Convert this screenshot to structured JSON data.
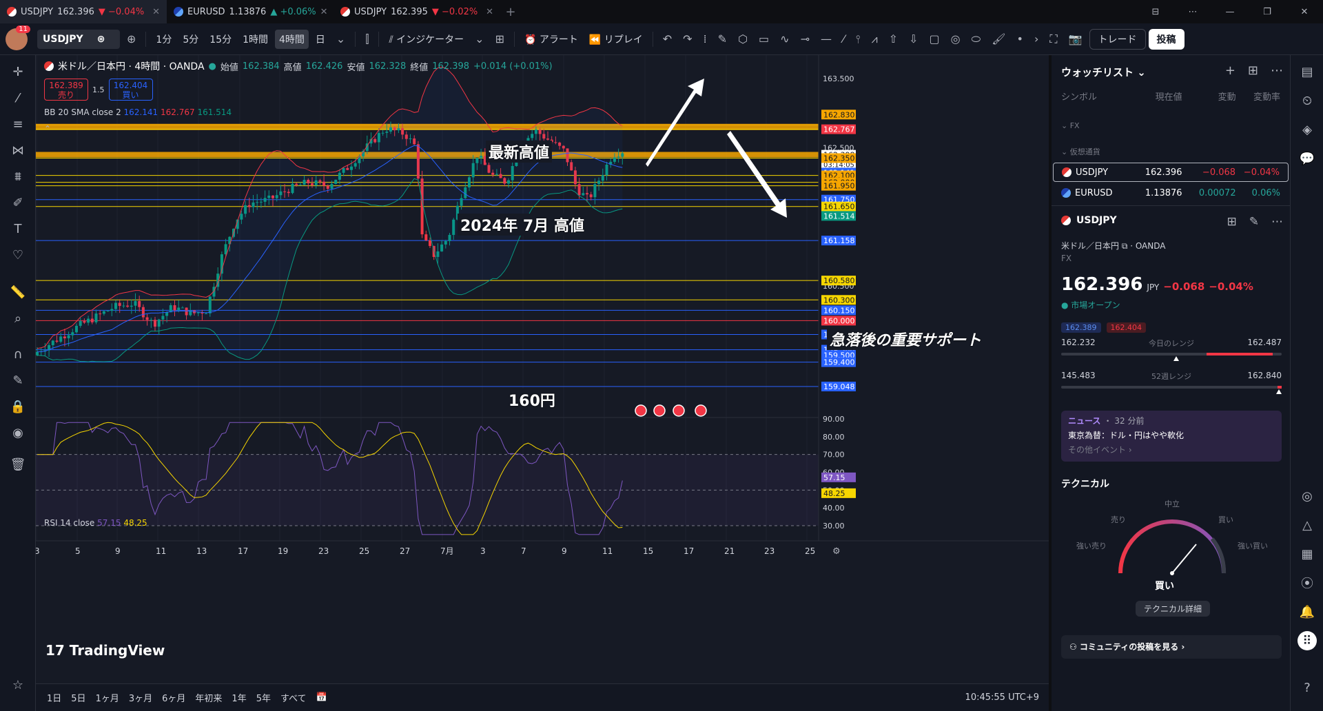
{
  "tabs": [
    {
      "symbol": "USDJPY",
      "price": "162.396",
      "change": "▼ −0.04%",
      "dir": "dn"
    },
    {
      "symbol": "EURUSD",
      "price": "1.13876",
      "change": "▲ +0.06%",
      "dir": "up"
    },
    {
      "symbol": "USDJPY",
      "price": "162.395",
      "change": "▼ −0.02%",
      "dir": "dn"
    }
  ],
  "toolbar": {
    "notif_count": "11",
    "symbol": "USDJPY",
    "intervals": [
      "1分",
      "5分",
      "15分",
      "1時間",
      "4時間",
      "日"
    ],
    "selected_interval": "4時間",
    "indicators": "インジケーター",
    "alert": "アラート",
    "replay": "リプレイ",
    "trade": "トレード",
    "post": "投稿"
  },
  "legend": {
    "title": "米ドル／日本円 · 4時間 · OANDA",
    "open_label": "始値",
    "open": "162.384",
    "high_label": "高値",
    "high": "162.426",
    "low_label": "安値",
    "low": "162.328",
    "close_label": "終値",
    "close": "162.398",
    "change": "+0.014 (+0.01%)"
  },
  "bidask": {
    "sell_price": "162.389",
    "sell_label": "売り",
    "spread": "1.5",
    "buy_price": "162.404",
    "buy_label": "買い"
  },
  "bb": {
    "label": "BB 20 SMA close 2",
    "mid": "162.141",
    "upper": "162.767",
    "lower": "161.514"
  },
  "rsi": {
    "label": "RSI 14 close",
    "value": "57.15",
    "ma": "48.25"
  },
  "annotations": {
    "latest_high": "最新高値",
    "july_high": "2024年 7月 高値",
    "support": "急落後の重要サポート",
    "yen160": "160円"
  },
  "price_axis": {
    "ticks": [
      "163.500",
      "163.000",
      "162.500",
      "160.500"
    ],
    "labels": [
      {
        "t": "162.830",
        "c": "#f7a600"
      },
      {
        "t": "162.767",
        "c": "#f23645"
      },
      {
        "t": "162.398",
        "c": "#ffffff"
      },
      {
        "t": "162.350",
        "c": "#f7a600"
      },
      {
        "t": "162.141",
        "c": "#2962ff"
      },
      {
        "t": "162.100",
        "c": "#f7a600"
      },
      {
        "t": "162.000",
        "c": "#f7a600"
      },
      {
        "t": "161.950",
        "c": "#f7a600"
      },
      {
        "t": "161.750",
        "c": "#2962ff"
      },
      {
        "t": "161.650",
        "c": "#f7d600"
      },
      {
        "t": "161.514",
        "c": "#089981"
      },
      {
        "t": "161.158",
        "c": "#2962ff"
      },
      {
        "t": "160.580",
        "c": "#f7d600"
      },
      {
        "t": "160.300",
        "c": "#f7d600"
      },
      {
        "t": "160.150",
        "c": "#2962ff"
      },
      {
        "t": "160.000",
        "c": "#f23645"
      },
      {
        "t": "159.800",
        "c": "#2962ff"
      },
      {
        "t": "159.580",
        "c": "#2962ff"
      },
      {
        "t": "159.500",
        "c": "#2962ff"
      },
      {
        "t": "159.400",
        "c": "#2962ff"
      },
      {
        "t": "159.048",
        "c": "#2962ff"
      }
    ],
    "countdown": "03:14:05"
  },
  "rsi_axis": {
    "ticks": [
      "90.00",
      "80.00",
      "70.00",
      "60.00",
      "50.00",
      "40.00",
      "30.00"
    ],
    "value": "57.15",
    "ma": "48.25"
  },
  "time_axis": [
    "3",
    "5",
    "9",
    "11",
    "13",
    "17",
    "19",
    "23",
    "25",
    "27",
    "7月",
    "3",
    "7",
    "9",
    "11",
    "15",
    "17",
    "21",
    "23",
    "25"
  ],
  "tv_logo": "TradingView",
  "bottom": {
    "ranges": [
      "1日",
      "5日",
      "1ヶ月",
      "3ヶ月",
      "6ヶ月",
      "年初来",
      "1年",
      "5年",
      "すべて"
    ],
    "clock": "10:45:55 UTC+9"
  },
  "watchlist": {
    "title": "ウォッチリスト",
    "cols": [
      "シンボル",
      "現在値",
      "変動",
      "変動率"
    ],
    "group_fx": "FX",
    "group_crypto": "仮想通貨",
    "rows": [
      {
        "sym": "USDJPY",
        "last": "162.396",
        "chg": "−0.068",
        "pct": "−0.04%",
        "neg": true
      },
      {
        "sym": "EURUSD",
        "last": "1.13876",
        "chg": "0.00072",
        "pct": "0.06%",
        "neg": false
      }
    ]
  },
  "detail": {
    "symbol": "USDJPY",
    "desc": "米ドル／日本円 ⧉ · OANDA",
    "type": "FX",
    "price": "162.396",
    "unit": "JPY",
    "change": "−0.068",
    "pct": "−0.04%",
    "status": "● 市場オープン",
    "bid": "162.389",
    "ask": "162.404",
    "day_low": "162.232",
    "day_label": "今日のレンジ",
    "day_high": "162.487",
    "wk_low": "145.483",
    "wk_label": "52週レンジ",
    "wk_high": "162.840"
  },
  "news": {
    "label": "ニュース",
    "age": "・ 32 分前",
    "title": "東京為替：ドル・円はやや軟化",
    "more": "その他イベント ›"
  },
  "technical": {
    "title": "テクニカル",
    "neutral": "中立",
    "sell": "売り",
    "buy": "買い",
    "strong_sell": "強い売り",
    "strong_buy": "強い買い",
    "result": "買い",
    "detail_btn": "テクニカル詳細"
  },
  "community": "⚇ コミュニティの投稿を見る ›"
}
